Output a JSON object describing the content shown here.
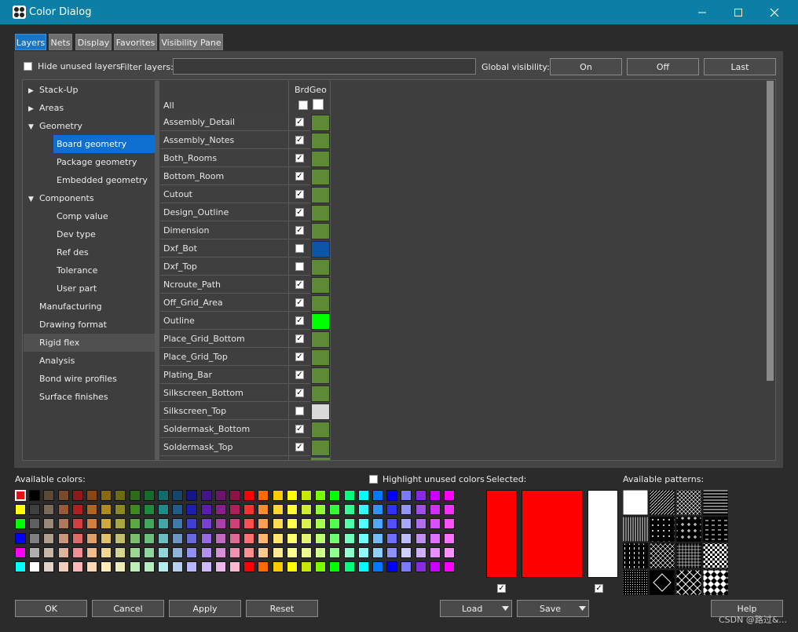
{
  "window": {
    "title": "Color Dialog",
    "minimize": "—",
    "maximize": "☐",
    "close": "✕"
  },
  "tabs": [
    {
      "label": "Layers",
      "active": true
    },
    {
      "label": "Nets",
      "active": false
    },
    {
      "label": "Display",
      "active": false
    },
    {
      "label": "Favorites",
      "active": false
    },
    {
      "label": "Visibility Pane",
      "active": false
    }
  ],
  "filters": {
    "hide_unused_label": "Hide unused layers",
    "filter_label": "Filter layers:",
    "filter_value": "",
    "global_visibility_label": "Global visibility:",
    "on": "On",
    "off": "Off",
    "last": "Last"
  },
  "tree": [
    {
      "label": "Stack-Up",
      "level": 0,
      "arrow": "right"
    },
    {
      "label": "Areas",
      "level": 0,
      "arrow": "right"
    },
    {
      "label": "Geometry",
      "level": 0,
      "arrow": "down"
    },
    {
      "label": "Board geometry",
      "level": 1,
      "selected": true
    },
    {
      "label": "Package geometry",
      "level": 1
    },
    {
      "label": "Embedded geometry",
      "level": 1
    },
    {
      "label": "Components",
      "level": 0,
      "arrow": "down"
    },
    {
      "label": "Comp value",
      "level": 1
    },
    {
      "label": "Dev type",
      "level": 1
    },
    {
      "label": "Ref des",
      "level": 1
    },
    {
      "label": "Tolerance",
      "level": 1
    },
    {
      "label": "User part",
      "level": 1
    },
    {
      "label": "Manufacturing",
      "level": 0
    },
    {
      "label": "Drawing format",
      "level": 0
    },
    {
      "label": "Rigid flex",
      "level": 0,
      "hover": true
    },
    {
      "label": "Analysis",
      "level": 0
    },
    {
      "label": "Bond wire profiles",
      "level": 0
    },
    {
      "label": "Surface finishes",
      "level": 0
    }
  ],
  "grid": {
    "column_header": "BrdGeo",
    "all_label": "All",
    "rows": [
      {
        "name": "Assembly_Detail",
        "checked": true,
        "color": "#5e8a36"
      },
      {
        "name": "Assembly_Notes",
        "checked": true,
        "color": "#5e8a36"
      },
      {
        "name": "Both_Rooms",
        "checked": true,
        "color": "#5e8a36"
      },
      {
        "name": "Bottom_Room",
        "checked": true,
        "color": "#5e8a36"
      },
      {
        "name": "Cutout",
        "checked": true,
        "color": "#5e8a36"
      },
      {
        "name": "Design_Outline",
        "checked": true,
        "color": "#5e8a36"
      },
      {
        "name": "Dimension",
        "checked": true,
        "color": "#5e8a36"
      },
      {
        "name": "Dxf_Bot",
        "checked": false,
        "color": "#0b56a8"
      },
      {
        "name": "Dxf_Top",
        "checked": false,
        "color": "#5e8a36"
      },
      {
        "name": "Ncroute_Path",
        "checked": true,
        "color": "#5e8a36"
      },
      {
        "name": "Off_Grid_Area",
        "checked": true,
        "color": "#5e8a36"
      },
      {
        "name": "Outline",
        "checked": true,
        "color": "#00ff00"
      },
      {
        "name": "Place_Grid_Bottom",
        "checked": true,
        "color": "#5e8a36"
      },
      {
        "name": "Place_Grid_Top",
        "checked": true,
        "color": "#5e8a36"
      },
      {
        "name": "Plating_Bar",
        "checked": true,
        "color": "#5e8a36"
      },
      {
        "name": "Silkscreen_Bottom",
        "checked": true,
        "color": "#5e8a36"
      },
      {
        "name": "Silkscreen_Top",
        "checked": false,
        "color": "#d9d9d9"
      },
      {
        "name": "Soldermask_Bottom",
        "checked": true,
        "color": "#5e8a36"
      },
      {
        "name": "Soldermask_Top",
        "checked": true,
        "color": "#5e8a36"
      }
    ]
  },
  "colors": {
    "available_label": "Available colors:",
    "highlight_unused_label": "Highlight unused colors",
    "palette": [
      [
        "#e81010",
        "#000000",
        "#5a4a3a",
        "#7a4a2a",
        "#8b1a1a",
        "#8b4513",
        "#8b6914",
        "#6b6b14",
        "#2d6b14",
        "#146b2d",
        "#146b6b",
        "#14456b",
        "#14148b",
        "#45148b",
        "#6b146b",
        "#8b1445",
        "#ff0000",
        "#ff6a00",
        "#ffcc00",
        "#ffff00",
        "#c8e600",
        "#7aff00",
        "#00ff00",
        "#00ff7a",
        "#00ffff",
        "#0078ff",
        "#0000ff",
        "#7a7aff",
        "#8a2be2",
        "#c800ff",
        "#ff00ff"
      ],
      [
        "#ffff00",
        "#404040",
        "#7a6a5a",
        "#9a5a3a",
        "#b02020",
        "#b0641e",
        "#b08a1e",
        "#8a8a1e",
        "#3e8a1e",
        "#1e8a3e",
        "#1e8a8a",
        "#1e5c8a",
        "#1e1eb0",
        "#5c1eb0",
        "#8a1e8a",
        "#b01e5c",
        "#ff3030",
        "#ff8a30",
        "#ffd530",
        "#ffff30",
        "#d2ec30",
        "#94ff30",
        "#30ff30",
        "#30ff94",
        "#30ffff",
        "#3094ff",
        "#3030ff",
        "#9494ff",
        "#a050e8",
        "#d030ff",
        "#ff30ff"
      ],
      [
        "#00ff00",
        "#606060",
        "#9a8a7a",
        "#b07a5a",
        "#d04040",
        "#d08040",
        "#d0a840",
        "#a8a840",
        "#5aa840",
        "#40a85a",
        "#40a8a8",
        "#407aa8",
        "#4040d0",
        "#7a40d0",
        "#a840a8",
        "#d0407a",
        "#ff5050",
        "#ffa050",
        "#ffdd50",
        "#ffff50",
        "#dcf050",
        "#a8ff50",
        "#50ff50",
        "#50ffa8",
        "#50ffff",
        "#50a8ff",
        "#5050ff",
        "#a8a8ff",
        "#b070ec",
        "#d850ff",
        "#ff50ff"
      ],
      [
        "#0000ff",
        "#808080",
        "#b0a090",
        "#c8967a",
        "#e06a6a",
        "#e0a06a",
        "#e0c06a",
        "#c0c06a",
        "#7ac06a",
        "#6ac07a",
        "#6ac0c0",
        "#6a96c0",
        "#6a6ae0",
        "#966ae0",
        "#c06ac0",
        "#e06a96",
        "#ff7070",
        "#ffb470",
        "#ffe470",
        "#ffff70",
        "#e6f470",
        "#bcff70",
        "#70ff70",
        "#70ffbc",
        "#70ffff",
        "#70bcff",
        "#7070ff",
        "#bcbcff",
        "#c090f0",
        "#e070ff",
        "#ff70ff"
      ],
      [
        "#ff00ff",
        "#b0b0b0",
        "#c8b8a8",
        "#deb49c",
        "#f09090",
        "#f0bc90",
        "#f0d690",
        "#d6d690",
        "#9cd690",
        "#90d69c",
        "#90d6d6",
        "#90b4d6",
        "#9090f0",
        "#b490f0",
        "#d690d6",
        "#f090b4",
        "#ff9090",
        "#ffc890",
        "#ffeb90",
        "#ffff90",
        "#f0f890",
        "#d0ff90",
        "#90ff90",
        "#90ffd0",
        "#90ffff",
        "#90d0ff",
        "#9090ff",
        "#d0d0ff",
        "#d0b0f4",
        "#e890ff",
        "#ff90ff"
      ],
      [
        "#00ffff",
        "#ffffff",
        "#e0d4c8",
        "#f0d0bc",
        "#ffb8b8",
        "#ffd8b8",
        "#ffecb8",
        "#ececb8",
        "#c0ecb8",
        "#b8ecc0",
        "#b8ecec",
        "#b8d0ec",
        "#b8b8ff",
        "#d0b8ff",
        "#ecb8ec",
        "#ffb8d0",
        "#ff0000",
        "#ff6a00",
        "#ffcc00",
        "#ffff00",
        "#c8e600",
        "#7aff00",
        "#00ff00",
        "#00ff7a",
        "#00ffff",
        "#0078ff",
        "#0000ff",
        "#7a7aff",
        "#8a2be2",
        "#c800ff",
        "#ff00ff"
      ]
    ]
  },
  "selected": {
    "label": "Selected:",
    "color_small": "#ff0000",
    "color_large": "#ff0000",
    "color_white": "#ffffff",
    "check1": "✓",
    "check2": "✓"
  },
  "patterns": {
    "label": "Available patterns:",
    "names": [
      "solid",
      "diag-dense",
      "diag-cross",
      "horizontal",
      "vertical",
      "dots-sparse",
      "plus-grid",
      "dash-grid",
      "dots-vertical",
      "diamond-grid",
      "square-grid",
      "checker-small",
      "dots-fine",
      "diamond-outline",
      "x-grid",
      "checker"
    ]
  },
  "footer": {
    "ok": "OK",
    "cancel": "Cancel",
    "apply": "Apply",
    "reset": "Reset",
    "load": "Load",
    "save": "Save",
    "help": "Help",
    "watermark": "CSDN @路过&..."
  }
}
